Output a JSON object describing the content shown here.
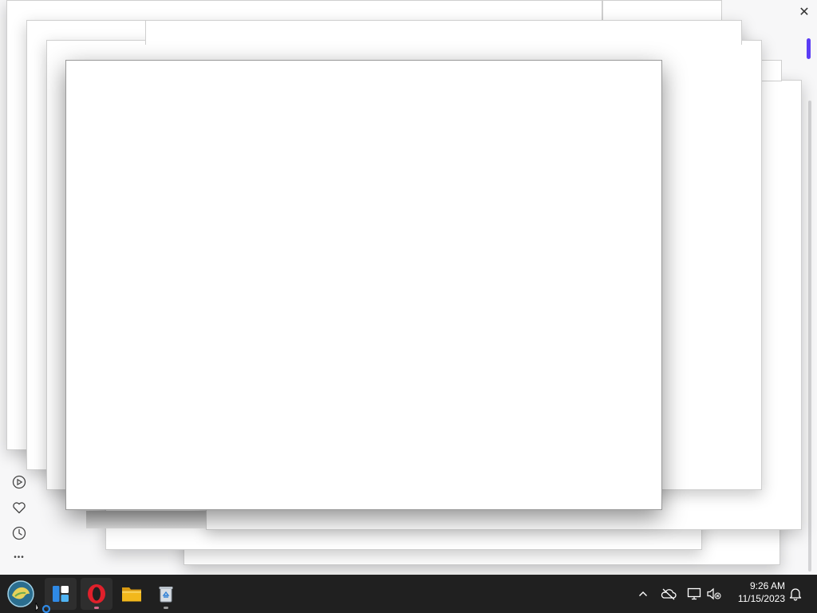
{
  "host": {
    "close_glyph": "✕",
    "accent_color": "#5b3df5"
  },
  "side_rail": {
    "items": [
      {
        "icon": "play-circle-icon"
      },
      {
        "icon": "heart-icon"
      },
      {
        "icon": "clock-icon"
      },
      {
        "icon": "more-icon",
        "glyph": "•••"
      }
    ]
  },
  "taskbar": {
    "apps": [
      {
        "icon": "start-icon"
      },
      {
        "icon": "widgets-icon"
      },
      {
        "icon": "opera-icon"
      },
      {
        "icon": "file-explorer-icon"
      },
      {
        "icon": "recycle-bin-icon"
      }
    ],
    "tray": {
      "icons": [
        "chevron-up-icon",
        "onedrive-icon",
        "network-icon",
        "volume-muted-icon",
        "notification-icon"
      ]
    },
    "clock": {
      "time": "9:26 AM",
      "date": "11/15/2023"
    }
  },
  "colors": {
    "taskbar_bg": "#202020",
    "opera_red": "#e0202b",
    "folder_yellow": "#f2b81c"
  }
}
